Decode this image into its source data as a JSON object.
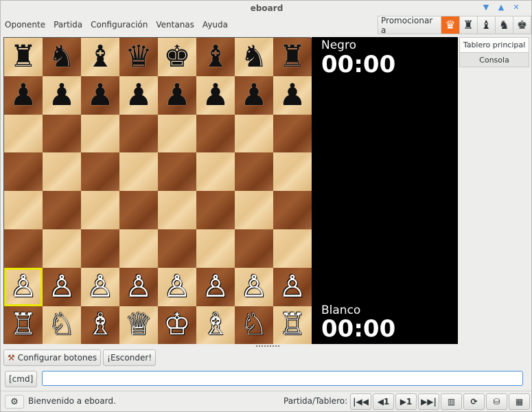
{
  "window": {
    "title": "eboard"
  },
  "menubar": {
    "items": [
      "Oponente",
      "Partida",
      "Configuración",
      "Ventanas",
      "Ayuda"
    ]
  },
  "promotion": {
    "label": "Promocionar a",
    "pieces": [
      "♛",
      "♜",
      "♝",
      "♞",
      "♚"
    ]
  },
  "board": {
    "rows": [
      [
        "♜",
        "♞",
        "♝",
        "♛",
        "♚",
        "♝",
        "♞",
        "♜"
      ],
      [
        "♟",
        "♟",
        "♟",
        "♟",
        "♟",
        "♟",
        "♟",
        "♟"
      ],
      [
        "",
        "",
        "",
        "",
        "",
        "",
        "",
        ""
      ],
      [
        "",
        "",
        "",
        "",
        "",
        "",
        "",
        ""
      ],
      [
        "",
        "",
        "",
        "",
        "",
        "",
        "",
        ""
      ],
      [
        "",
        "",
        "",
        "",
        "",
        "",
        "",
        ""
      ],
      [
        "♙",
        "♙",
        "♙",
        "♙",
        "♙",
        "♙",
        "♙",
        "♙"
      ],
      [
        "♖",
        "♘",
        "♗",
        "♕",
        "♔",
        "♗",
        "♘",
        "♖"
      ]
    ]
  },
  "clocks": {
    "black_name": "Negro",
    "black_time": "00:00",
    "white_name": "Blanco",
    "white_time": "00:00"
  },
  "tabs": [
    "Tablero principal",
    "Consola"
  ],
  "buttons": {
    "configure": "Configurar botones",
    "hide": "¡Esconder!"
  },
  "command": {
    "label": "[cmd]",
    "value": ""
  },
  "status": {
    "message": "Bienvenido a eboard.",
    "nav_label": "Partida/Tablero:"
  },
  "nav": {
    "first": "|◀◀",
    "prev": "◀1",
    "next": "▶1",
    "last": "▶▶|"
  }
}
